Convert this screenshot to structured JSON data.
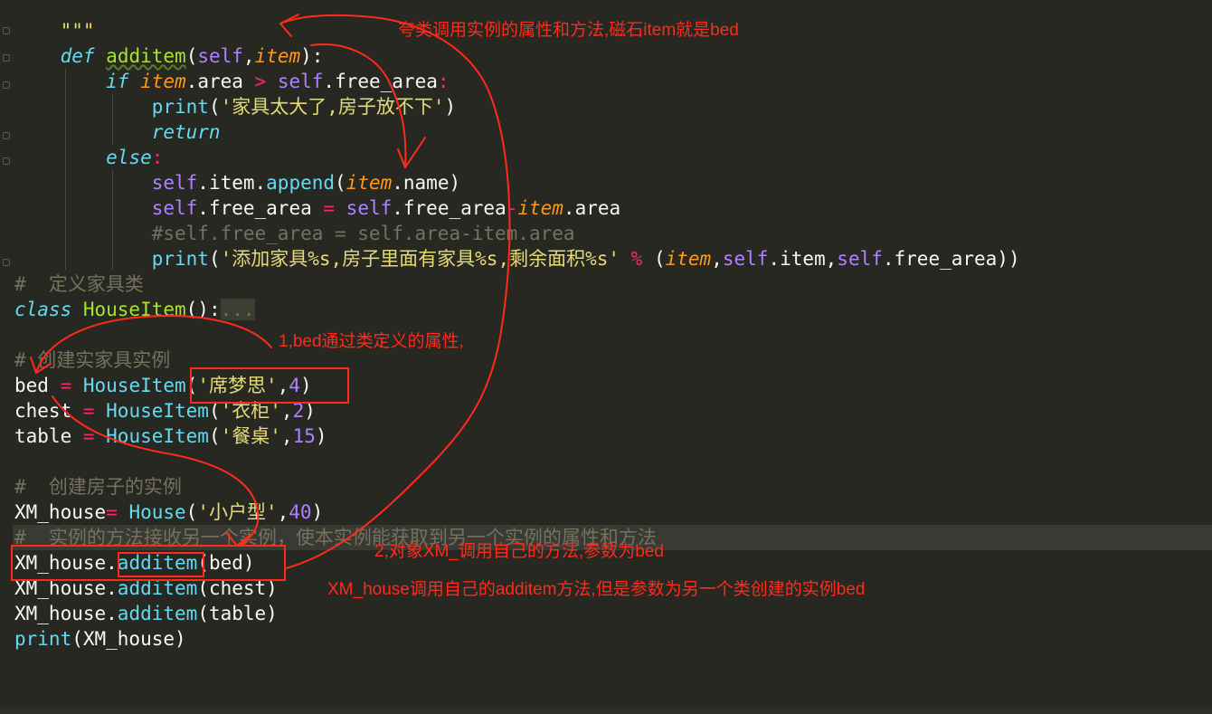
{
  "code": {
    "docstring_end": "\"\"\"",
    "def_kw": "def",
    "def_name": "additem",
    "def_params_open": "(",
    "def_self": "self",
    "def_comma": ",",
    "def_item": "item",
    "def_close": "):",
    "if_kw": "if",
    "if_item": "item",
    "if_attr": ".area ",
    "if_op": ">",
    "if_self": " self",
    "if_rest": ".free_area",
    "if_colon": ":",
    "print1_fn": "print",
    "print1_open": "(",
    "print1_str": "'家具太大了,房子放不下'",
    "print1_close": ")",
    "return_kw": "return",
    "else_kw": "else",
    "else_colon": ":",
    "append_self": "self",
    "append_mid": ".item.",
    "append_fn": "append",
    "append_open": "(",
    "append_item": "item",
    "append_rest": ".name)",
    "fa_self1": "self",
    "fa_mid1": ".free_area ",
    "fa_eq": "=",
    "fa_self2": " self",
    "fa_mid2": ".free_area",
    "fa_minus": "-",
    "fa_item": "item",
    "fa_rest": ".area",
    "commented_line": "#self.free_area = self.area-item.area",
    "print2_fn": "print",
    "print2_open": "(",
    "print2_str": "'添加家具%s,房子里面有家具%s,剩余面积%s'",
    "print2_pct": " % ",
    "print2_paren": "(",
    "print2_item": "item",
    "print2_comma1": ",",
    "print2_self1": "self",
    "print2_mid1": ".item,",
    "print2_self2": "self",
    "print2_mid2": ".free_area))",
    "comment_define": "#  定义家具类",
    "class_kw": "class",
    "class_name": " HouseItem",
    "class_paren": "():",
    "class_fold": "...",
    "comment_create_item": "# 创建实家具实例",
    "bed_name": "bed",
    "bed_eq": " = ",
    "bed_cls": "HouseItem",
    "bed_open": "(",
    "bed_str": "'席梦思'",
    "bed_comma": ",",
    "bed_num": "4",
    "bed_close": ")",
    "chest_name": "chest",
    "chest_eq": " = ",
    "chest_cls": "HouseItem",
    "chest_open": "(",
    "chest_str": "'衣柜'",
    "chest_comma": ",",
    "chest_num": "2",
    "chest_close": ")",
    "table_name": "table",
    "table_eq": " = ",
    "table_cls": "HouseItem",
    "table_open": "(",
    "table_str": "'餐桌'",
    "table_comma": ",",
    "table_num": "15",
    "table_close": ")",
    "comment_create_house": "#  创建房子的实例",
    "xm_name": "XM_house",
    "xm_eq": "= ",
    "xm_cls": "House",
    "xm_open": "(",
    "xm_str": "'小户型'",
    "xm_comma": ",",
    "xm_num": "40",
    "xm_close": ")",
    "comment_method": "#  实例的方法接收另一个实例，使本实例能获取到另一个实例的属性和方法",
    "call1_obj": "XM_house.",
    "call1_fn": "additem",
    "call1_arg": "(bed)",
    "call2_obj": "XM_house.",
    "call2_fn": "additem",
    "call2_arg": "(chest)",
    "call3_obj": "XM_house.",
    "call3_fn": "additem",
    "call3_arg": "(table)",
    "print3_fn": "print",
    "print3_arg": "(XM_house)"
  },
  "annotations": {
    "top": "夸类调用实例的属性和方法,磁石item就是bed",
    "bed_def": "1,bed通过类定义的属性,",
    "call": "2,对象XM_调用自己的方法,参数为bed",
    "explain": "XM_house调用自己的additem方法,但是参数为另一个类创建的实例bed"
  },
  "colors": {
    "background": "#272822",
    "annotation": "#ff2a1a"
  }
}
